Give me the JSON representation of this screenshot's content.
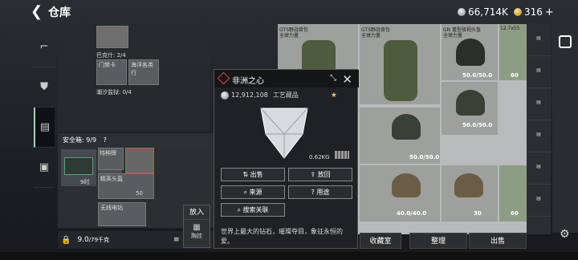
{
  "header": {
    "title": "仓库",
    "silver": "66,714K",
    "gold": "316"
  },
  "left_panel": {
    "label_ba": "巴克什: 2/4",
    "label_ch": "潮汐监狱: 0/4",
    "tile_a": "门禁卡",
    "tile_b": "海洋各类行"
  },
  "safe": {
    "title": "安全箱: 9/9",
    "timer": "9时",
    "item_a": "特种牌",
    "item_b": "精英头盔",
    "item_c": "无线电钻",
    "count": "50"
  },
  "weight": {
    "value": "9.0",
    "max": "/79千克"
  },
  "popover": {
    "put": "放入",
    "chest": "胸挂"
  },
  "dialog": {
    "title": "非洲之心",
    "price": "12,912,108",
    "tag": "工艺藏品",
    "weight": "0.62KG",
    "buttons": [
      "出售",
      "放回",
      "来源",
      "用途",
      "搜索关联"
    ],
    "description": "世界上最大的钻石，璀璨夺目，象征永恒的爱。"
  },
  "right_grid": {
    "headers": [
      "GTS野战背包",
      "GTS野战背包",
      "GN 重型夜视头盔",
      "12.7x55"
    ],
    "sub": [
      "全琥力量",
      "全琥力量",
      "全琥力量"
    ],
    "values": [
      "50.0/50.0",
      "60",
      "30",
      "50.0/50.0",
      "50.0/50.0",
      "40.0/40.0",
      "30",
      "60"
    ]
  },
  "bottom": {
    "buttons": [
      "收藏室",
      "整理",
      "出售"
    ]
  }
}
